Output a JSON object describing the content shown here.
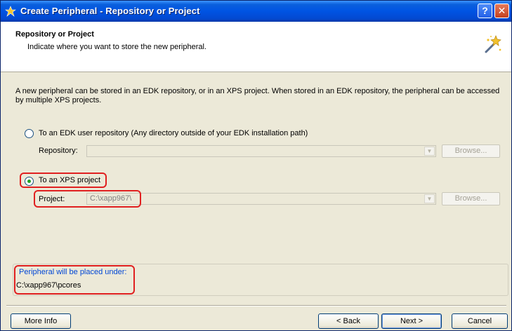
{
  "window": {
    "title": "Create Peripheral - Repository or Project",
    "help_label": "?",
    "close_label": "✕"
  },
  "header": {
    "title": "Repository or Project",
    "subtitle": "Indicate where you want to store the new peripheral."
  },
  "description": "A new peripheral can be stored in an EDK repository, or in an XPS project. When stored in an EDK repository, the peripheral can be accessed by multiple XPS projects.",
  "options": {
    "repository_radio_label": "To an EDK user repository (Any directory outside of your EDK installation path)",
    "repository_field_label": "Repository:",
    "repository_value": "",
    "xps_radio_label": "To an XPS project",
    "project_field_label": "Project:",
    "project_value": "C:\\xapp967\\",
    "browse_label": "Browse...",
    "selected": "xps_project"
  },
  "placement": {
    "title": "Peripheral will be placed under:",
    "path": "C:\\xapp967\\pcores"
  },
  "footer": {
    "more_info": "More Info",
    "back": "< Back",
    "next": "Next >",
    "cancel": "Cancel"
  },
  "colors": {
    "titlebar": "#0054e3",
    "highlight": "#e02020",
    "link_text": "#0046d5"
  }
}
